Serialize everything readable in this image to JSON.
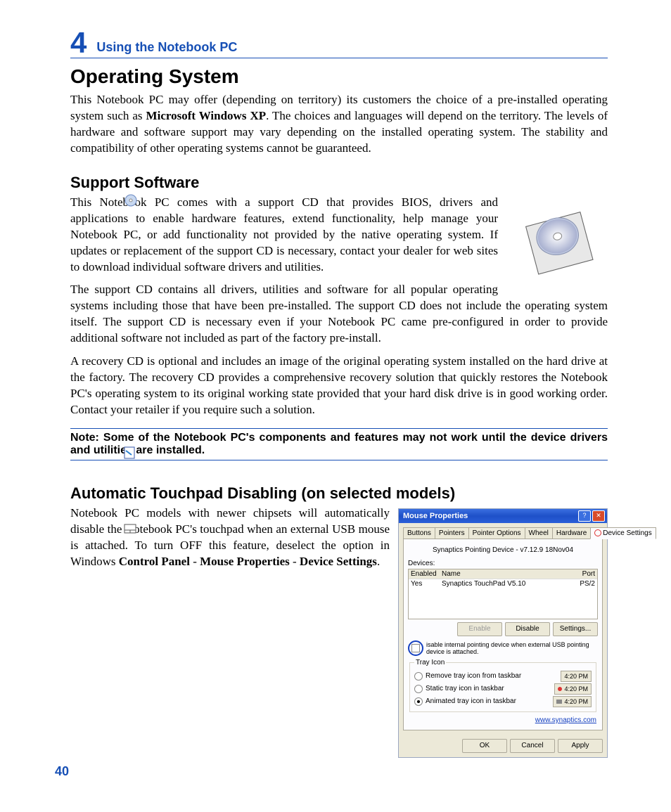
{
  "chapter": {
    "number": "4",
    "title": "Using the Notebook PC"
  },
  "section1": {
    "heading": "Operating System",
    "p1a": "This Notebook PC may offer (depending on territory) its customers the choice of a pre-installed operating system such as ",
    "p1b": "Microsoft Windows XP",
    "p1c": ". The choices and languages will depend on the territory. The levels of hardware and software support may vary depending on the installed operating system. The stability and compatibility of other operating systems cannot be guaranteed."
  },
  "section2": {
    "heading": "Support Software",
    "p1": "This Notebook PC comes with a support CD that provides BIOS, drivers and applications to enable hardware features, extend functionality, help manage your Notebook PC, or add functionality not provided by the native operating system. If updates or replacement of the support CD is necessary, contact your dealer for web sites to download individual software drivers and utilities.",
    "p2": "The support CD contains all drivers, utilities and software for all popular operating systems including those that have been pre-installed. The support CD does not include the operating system itself. The support CD is necessary even if your Notebook PC came pre-configured in order to provide additional software not included as part of the factory pre-install.",
    "p3": "A recovery CD is optional and includes an image of the original operating system installed on the hard drive at the factory. The recovery CD provides a comprehensive recovery solution that quickly restores the Notebook PC's operating system to its original working state provided that your hard disk drive is in good working order. Contact your retailer if you require such a solution."
  },
  "note": "Note: Some of the Notebook PC's components and features may not work until the device drivers and utilities are installed.",
  "section3": {
    "heading": "Automatic Touchpad Disabling (on selected models)",
    "p1a": "Notebook PC models with newer chipsets will automatically disable the Notebook PC's touchpad when an external USB mouse is attached. To turn OFF this feature, deselect the option in Windows ",
    "p1b": "Control Panel",
    "p1c": " - ",
    "p1d": "Mouse Properties",
    "p1e": " - ",
    "p1f": "Device Settings",
    "p1g": "."
  },
  "dialog": {
    "title": "Mouse Properties",
    "tabs": [
      "Buttons",
      "Pointers",
      "Pointer Options",
      "Wheel",
      "Hardware",
      "Device Settings"
    ],
    "version": "Synaptics Pointing Device - v7.12.9 18Nov04",
    "devices_label": "Devices:",
    "cols": {
      "enabled": "Enabled",
      "name": "Name",
      "port": "Port"
    },
    "row": {
      "enabled": "Yes",
      "name": "Synaptics TouchPad V5.10",
      "port": "PS/2"
    },
    "buttons": {
      "enable": "Enable",
      "disable": "Disable",
      "settings": "Settings..."
    },
    "checkbox": "isable internal pointing device when external USB pointing device is attached.",
    "tray_legend": "Tray Icon",
    "radios": [
      "Remove tray icon from taskbar",
      "Static tray icon in taskbar",
      "Animated tray icon in taskbar"
    ],
    "time": "4:20 PM",
    "link": "www.synaptics.com",
    "footer": {
      "ok": "OK",
      "cancel": "Cancel",
      "apply": "Apply"
    }
  },
  "page_number": "40"
}
